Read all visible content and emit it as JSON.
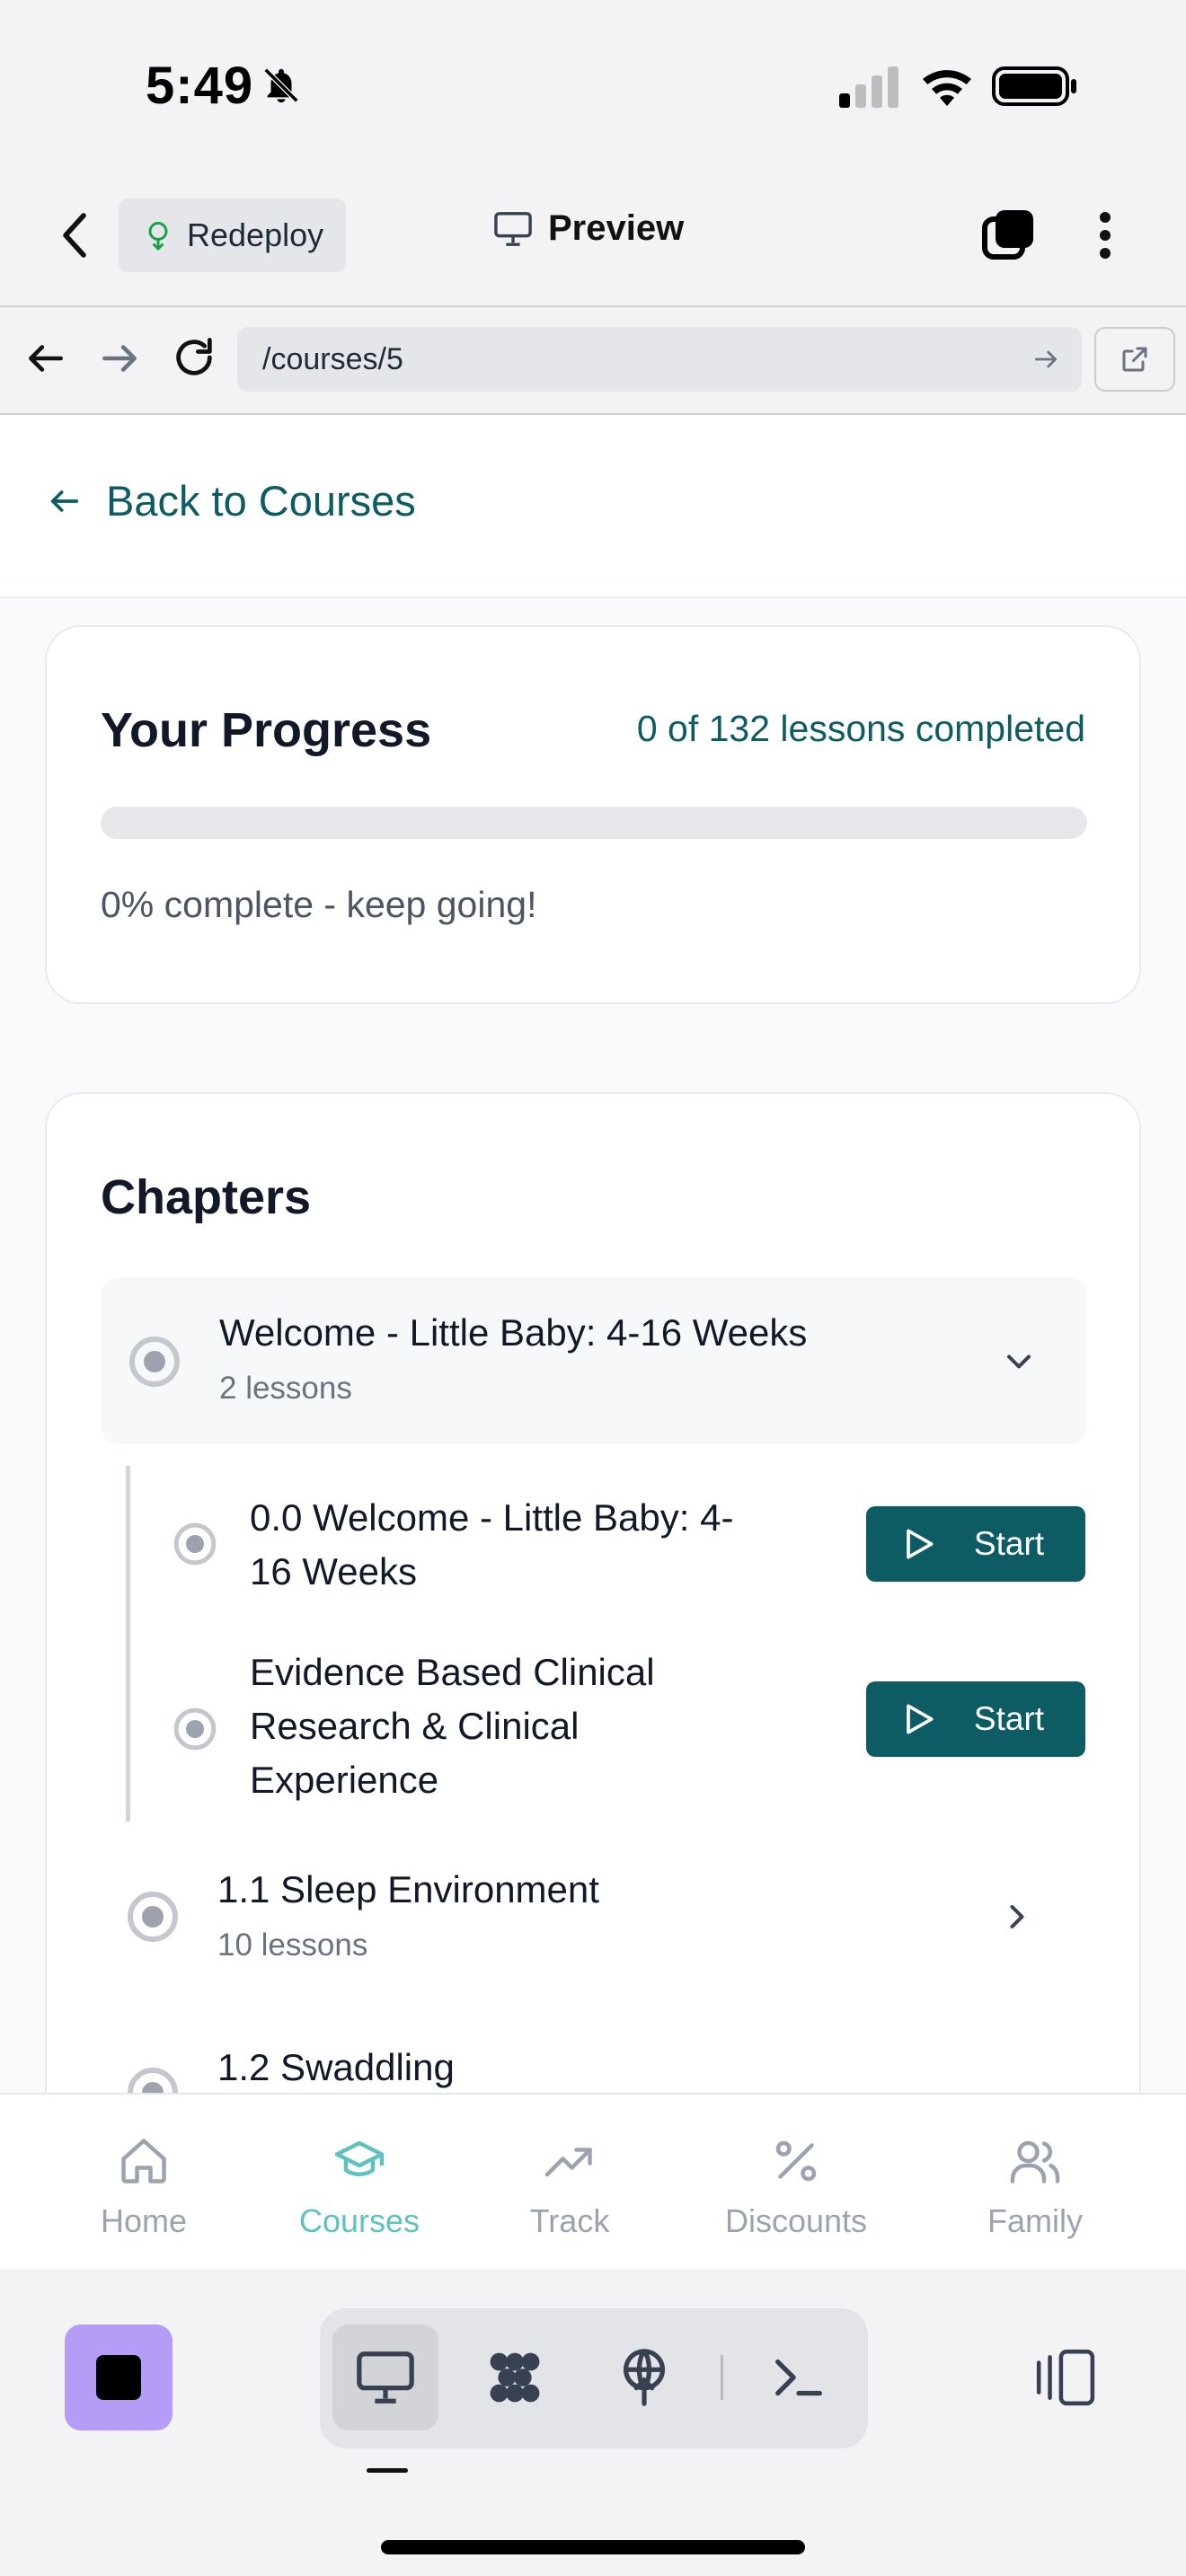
{
  "status_bar": {
    "time": "5:49"
  },
  "header": {
    "redeploy_label": "Redeploy",
    "title": "Preview"
  },
  "browser": {
    "url": "/courses/5"
  },
  "page": {
    "back_label": "Back to Courses",
    "progress": {
      "title": "Your Progress",
      "count": "0 of 132 lessons completed",
      "percent": 0,
      "note": "0% complete - keep going!"
    },
    "chapters": {
      "title": "Chapters",
      "items": [
        {
          "title": "Welcome - Little Baby: 4-16 Weeks",
          "subtitle": "2 lessons",
          "expanded": true
        },
        {
          "title": "1.1 Sleep Environment",
          "subtitle": "10 lessons",
          "expanded": false
        },
        {
          "title": "1.2 Swaddling",
          "subtitle": "",
          "expanded": false
        }
      ],
      "lessons": [
        {
          "title_line1": "0.0 Welcome - Little Baby: 4-",
          "title_line2": "16 Weeks",
          "action": "Start"
        },
        {
          "title_line1": "Evidence Based Clinical",
          "title_line2": "Research & Clinical",
          "title_line3": "Experience",
          "action": "Start"
        }
      ]
    }
  },
  "bottom_nav": {
    "items": [
      {
        "label": "Home",
        "icon": "home-icon"
      },
      {
        "label": "Courses",
        "icon": "graduation-cap-icon",
        "active": true
      },
      {
        "label": "Track",
        "icon": "trending-up-icon"
      },
      {
        "label": "Discounts",
        "icon": "percent-icon"
      },
      {
        "label": "Family",
        "icon": "users-icon"
      }
    ]
  },
  "colors": {
    "accent": "#0e5c63",
    "active_nav": "#5ec3c0",
    "stop_button": "#b49cf7"
  }
}
